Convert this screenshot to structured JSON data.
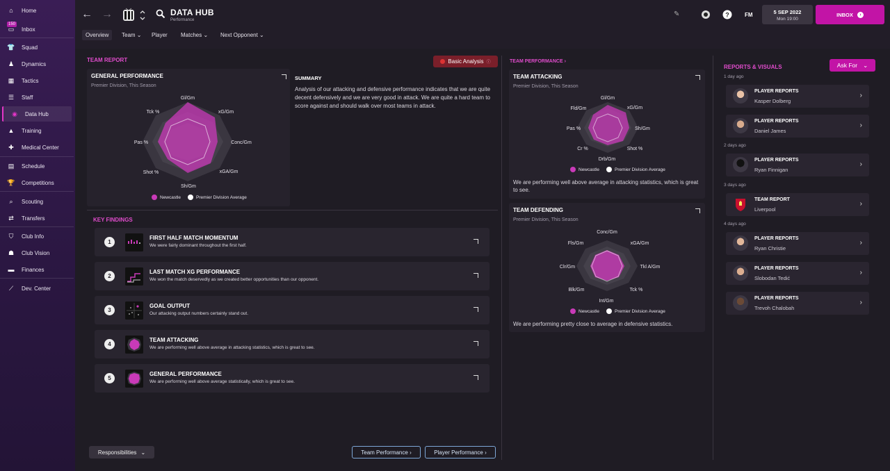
{
  "sidebar": {
    "inbox_badge": "150",
    "items": [
      {
        "label": "Home",
        "icon": "home-icon"
      },
      {
        "label": "Inbox",
        "icon": "inbox-icon"
      },
      {
        "label": "Squad",
        "icon": "shirt-icon"
      },
      {
        "label": "Dynamics",
        "icon": "dynamics-icon"
      },
      {
        "label": "Tactics",
        "icon": "tactics-icon"
      },
      {
        "label": "Staff",
        "icon": "staff-icon"
      },
      {
        "label": "Data Hub",
        "icon": "data-hub-icon"
      },
      {
        "label": "Training",
        "icon": "training-icon"
      },
      {
        "label": "Medical Center",
        "icon": "medical-icon"
      },
      {
        "label": "Schedule",
        "icon": "calendar-icon"
      },
      {
        "label": "Competitions",
        "icon": "trophy-icon"
      },
      {
        "label": "Scouting",
        "icon": "search-icon"
      },
      {
        "label": "Transfers",
        "icon": "transfer-icon"
      },
      {
        "label": "Club Info",
        "icon": "shield-icon"
      },
      {
        "label": "Club Vision",
        "icon": "vision-icon"
      },
      {
        "label": "Finances",
        "icon": "wallet-icon"
      },
      {
        "label": "Dev. Center",
        "icon": "dev-center-icon"
      }
    ]
  },
  "header": {
    "title": "DATA HUB",
    "subtitle": "Performance",
    "tabs": [
      "Overview",
      "Team",
      "Player",
      "Matches",
      "Next Opponent"
    ],
    "fm_label": "FM",
    "date": "5 SEP 2022",
    "time": "Mon 19:00",
    "inbox_label": "INBOX"
  },
  "team_report": {
    "heading": "TEAM REPORT",
    "analysis_btn": "Basic Analysis",
    "general": {
      "title": "GENERAL PERFORMANCE",
      "sub": "Premier Division, This Season",
      "axes": [
        "Gl/Gm",
        "xG/Gm",
        "Conc/Gm",
        "xGA/Gm",
        "Sh/Gm",
        "Shot %",
        "Pas %",
        "Tck %"
      ],
      "legend_a": "Newcastle",
      "legend_b": "Premier Division Average"
    },
    "summary_title": "SUMMARY",
    "summary_text": "Analysis of our attacking and defensive performance indicates that we are quite decent defensively and we are very good in attack. We are quite a hard team to score against and should walk over most teams in attack."
  },
  "key_findings": {
    "heading": "KEY FINDINGS",
    "items": [
      {
        "num": "1",
        "title": "FIRST HALF MATCH MOMENTUM",
        "desc": "We were fairly dominant throughout the first half."
      },
      {
        "num": "2",
        "title": "LAST MATCH XG PERFORMANCE",
        "desc": "We won the match deservedly as we created better opportunities than our opponent."
      },
      {
        "num": "3",
        "title": "GOAL OUTPUT",
        "desc": "Our attacking output numbers certainly stand out."
      },
      {
        "num": "4",
        "title": "TEAM ATTACKING",
        "desc": "We are performing well above average in attacking statistics, which is great to see."
      },
      {
        "num": "5",
        "title": "GENERAL PERFORMANCE",
        "desc": "We are performing well above average statistically, which is great to see."
      }
    ]
  },
  "team_performance": {
    "heading": "TEAM PERFORMANCE",
    "attacking": {
      "title": "TEAM ATTACKING",
      "sub": "Premier Division, This Season",
      "axes": [
        "Gl/Gm",
        "xG/Gm",
        "Sh/Gm",
        "Shot %",
        "Drb/Gm",
        "Cr %",
        "Pas %",
        "Fld/Gm"
      ],
      "legend_a": "Newcastle",
      "legend_b": "Premier Division Average",
      "note": "We are performing well above average in attacking statistics, which is great to see."
    },
    "defending": {
      "title": "TEAM DEFENDING",
      "sub": "Premier Division, This Season",
      "axes": [
        "Conc/Gm",
        "xGA/Gm",
        "Tkl A/Gm",
        "Tck %",
        "Int/Gm",
        "Blk/Gm",
        "Clr/Gm",
        "Fls/Gm"
      ],
      "legend_a": "Newcastle",
      "legend_b": "Premier Division Average",
      "note": "We are performing pretty close to average in defensive statistics."
    }
  },
  "reports": {
    "heading": "REPORTS & VISUALS",
    "ask_for": "Ask For",
    "groups": [
      {
        "day": "1 day ago",
        "items": [
          {
            "type": "PLAYER REPORTS",
            "name": "Kasper Dolberg"
          },
          {
            "type": "PLAYER REPORTS",
            "name": "Daniel James"
          }
        ]
      },
      {
        "day": "2 days ago",
        "items": [
          {
            "type": "PLAYER REPORTS",
            "name": "Ryan Finnigan"
          }
        ]
      },
      {
        "day": "3 days ago",
        "items": [
          {
            "type": "TEAM REPORT",
            "name": "Liverpool"
          }
        ]
      },
      {
        "day": "4 days ago",
        "items": [
          {
            "type": "PLAYER REPORTS",
            "name": "Ryan Christie"
          },
          {
            "type": "PLAYER REPORTS",
            "name": "Slobodan Tedić"
          },
          {
            "type": "PLAYER REPORTS",
            "name": "Trevoh Chalobah"
          }
        ]
      }
    ]
  },
  "footer": {
    "responsibilities": "Responsibilities",
    "team_perf_btn": "Team Performance",
    "player_perf_btn": "Player Performance"
  },
  "colors": {
    "accent": "#c214a6",
    "team_series": "#c93ab8",
    "average_series": "#ffffff"
  }
}
